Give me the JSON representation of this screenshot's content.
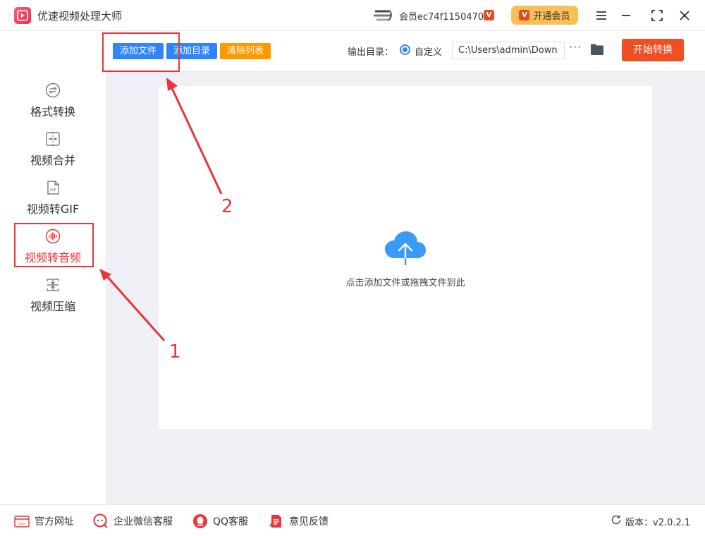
{
  "app": {
    "title": "优速视频处理大师"
  },
  "account": {
    "member_text": "会员ec74f1150470",
    "vip_badge": "V",
    "open_vip_label": "开通会员"
  },
  "sidebar": {
    "items": [
      {
        "label": "格式转换",
        "icon": "format-convert-icon",
        "active": false
      },
      {
        "label": "视频合并",
        "icon": "video-merge-icon",
        "active": false
      },
      {
        "label": "视频转GIF",
        "icon": "gif-icon",
        "active": false
      },
      {
        "label": "视频转音频",
        "icon": "video-to-audio-icon",
        "active": true
      },
      {
        "label": "视频压缩",
        "icon": "video-compress-icon",
        "active": false
      }
    ]
  },
  "toolbar": {
    "add_file": "添加文件",
    "add_folder": "添加目录",
    "clear_list": "清除列表",
    "output_label": "输出目录：",
    "custom_option": "自定义",
    "output_path": "C:\\Users\\admin\\Downlo",
    "more": "···",
    "start": "开始转换"
  },
  "main": {
    "drop_hint": "点击添加文件或拖拽文件到此"
  },
  "footer": {
    "website": "官方网址",
    "wecom": "企业微信客服",
    "qq": "QQ客服",
    "feedback": "意见反馈",
    "version": "版本：v2.0.2.1"
  },
  "annotations": {
    "step1": "1",
    "step2": "2"
  },
  "colors": {
    "accent_red": "#e8343a",
    "start_orange": "#f04e23",
    "btn_blue": "#2f86f6",
    "btn_orange": "#ff9900",
    "vip_gold": "#fbbf55"
  }
}
